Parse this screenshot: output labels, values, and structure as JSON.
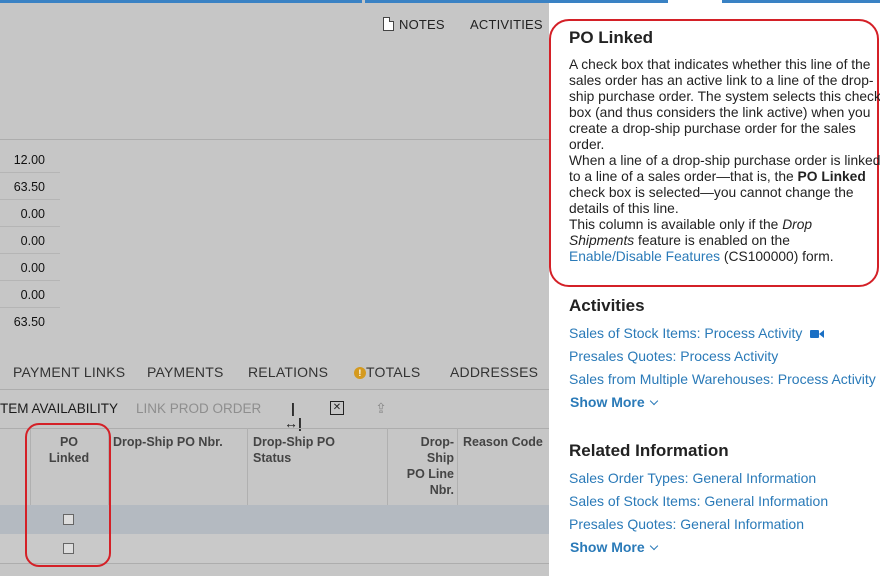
{
  "toolbar": {
    "notes_label": "NOTES",
    "activities_label": "ACTIVITIES"
  },
  "values": [
    "12.00",
    "63.50",
    "0.00",
    "0.00",
    "0.00",
    "0.00",
    "63.50"
  ],
  "tabs": {
    "payment_links": "PAYMENT LINKS",
    "payments": "PAYMENTS",
    "relations": "RELATIONS",
    "totals": "TOTALS",
    "addresses": "ADDRESSES"
  },
  "grid_toolbar": {
    "item_availability": "TEM AVAILABILITY",
    "link_prod_order": "LINK PROD ORDER"
  },
  "grid": {
    "headers": {
      "po_linked": "PO Linked",
      "drop_ship_po_nbr": "Drop-Ship PO Nbr.",
      "drop_ship_po_status": "Drop-Ship PO Status",
      "drop_ship_po_line_nbr": "Drop-Ship PO Line Nbr.",
      "reason_code": "Reason Code"
    },
    "rows": [
      {
        "po_linked": false
      },
      {
        "po_linked": false
      }
    ]
  },
  "help": {
    "title": "PO Linked",
    "desc": {
      "p1": "A check box that indicates whether this line of the sales order has an active link to a line of the drop-ship purchase order. The system selects this check box (and thus considers the link active) when you create a drop-ship purchase order for the sales order.",
      "p2_a": "When a line of a drop-ship purchase order is linked to a line of a sales order—that is, the ",
      "p2_b": "PO Linked",
      "p2_c": " check box is selected—you cannot change the details of this line.",
      "p3_a": "This column is available only if the ",
      "p3_b": "Drop Shipments",
      "p3_c": " feature is enabled on the ",
      "p3_link": "Enable/Disable Features",
      "p3_d": " (CS100000) form."
    },
    "activities_title": "Activities",
    "activities": [
      "Sales of Stock Items: Process Activity",
      "Presales Quotes: Process Activity",
      "Sales from Multiple Warehouses: Process Activity"
    ],
    "show_more": "Show More",
    "related_title": "Related Information",
    "related": [
      "Sales Order Types: General Information",
      "Sales of Stock Items: General Information",
      "Presales Quotes: General Information"
    ],
    "show_more_2": "Show More"
  },
  "colors": {
    "accent": "#3a82c4",
    "link": "#2a7ab8",
    "highlight": "#d42027",
    "warning": "#d49a1f"
  }
}
